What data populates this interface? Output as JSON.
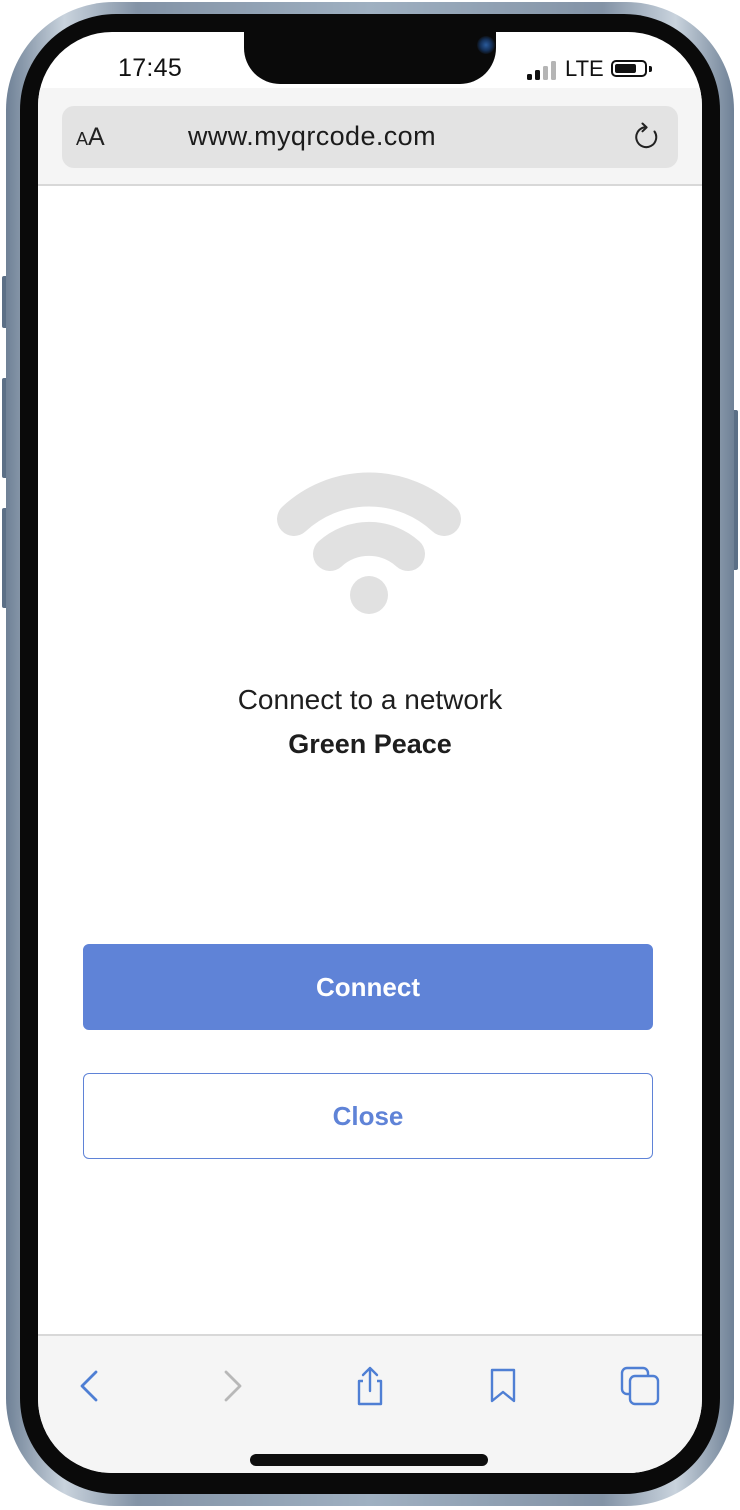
{
  "status_bar": {
    "time": "17:45",
    "network": "LTE",
    "signal_bars_active": 2,
    "signal_bars_total": 4
  },
  "address_bar": {
    "text_size_small": "A",
    "text_size_large": "A",
    "url": "www.myqrcode.com"
  },
  "content": {
    "icon": "wifi-icon",
    "heading": "Connect to a network",
    "network_name": "Green Peace"
  },
  "buttons": {
    "connect_label": "Connect",
    "close_label": "Close"
  },
  "toolbar": {
    "items": [
      "back-icon",
      "forward-icon",
      "share-icon",
      "bookmarks-icon",
      "tabs-icon"
    ]
  },
  "colors": {
    "accent": "#5f83d7",
    "icon_gray": "#e1e1e1",
    "toolbar_icon": "#4f7fd4",
    "toolbar_icon_disabled": "#b8b8b8"
  }
}
